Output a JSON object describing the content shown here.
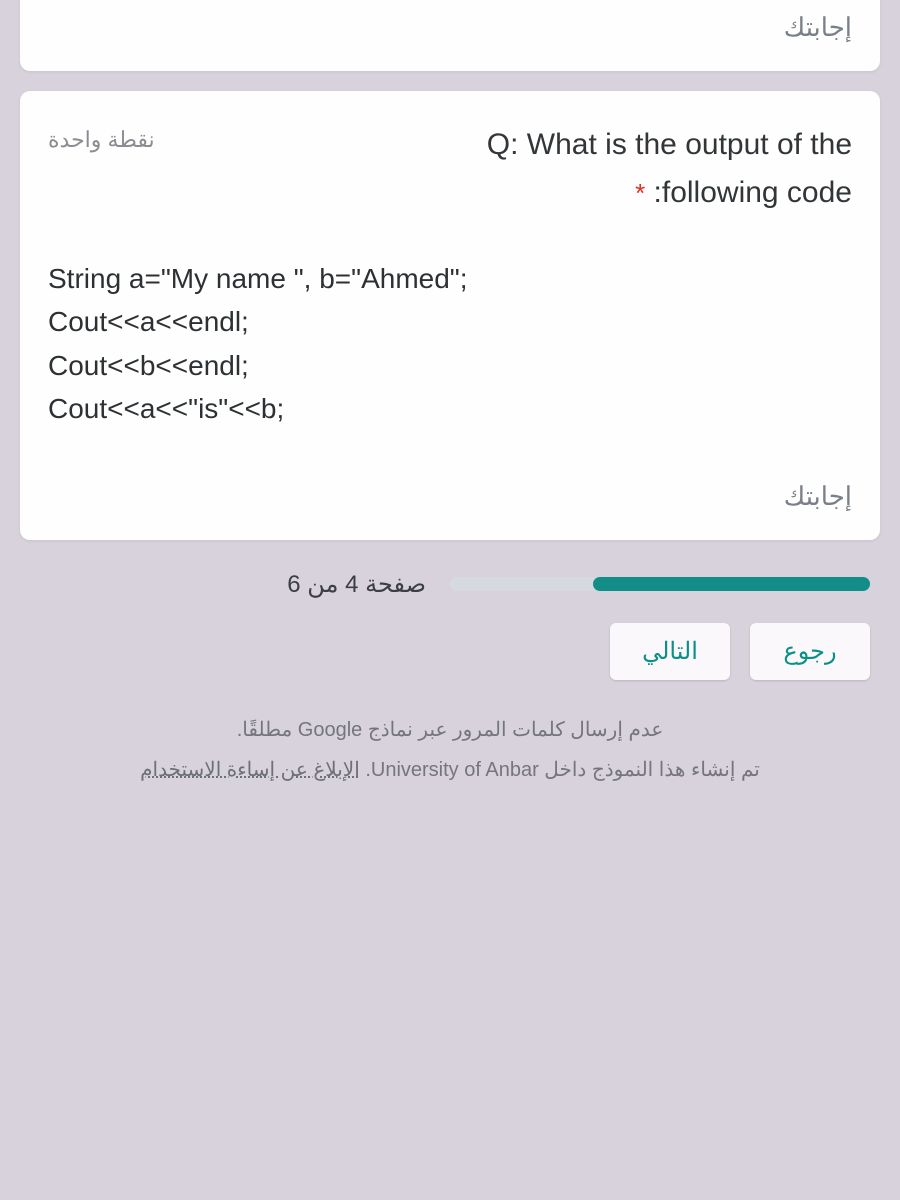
{
  "top_answer_label": "إجابتك",
  "question": {
    "points": "نقطة واحدة",
    "title_line1": "Q: What is the output of the",
    "title_line2": ":following code",
    "required_mark": "*",
    "code": "String a=\"My name \", b=\"Ahmed\";\nCout<<a<<endl;\nCout<<b<<endl;\nCout<<a<<\"is\"<<b;",
    "answer_label": "إجابتك"
  },
  "progress": {
    "page_label": "صفحة 4 من 6",
    "percent": 66
  },
  "buttons": {
    "back": "رجوع",
    "next": "التالي"
  },
  "footer": {
    "line1": "عدم إرسال كلمات المرور عبر نماذج Google مطلقًا.",
    "line2_pre": "تم إنشاء هذا النموذج داخل ",
    "line2_org": "University of Anbar",
    "line2_post": ". ",
    "report": "الإبلاغ عن إساءة الاستخدام"
  }
}
